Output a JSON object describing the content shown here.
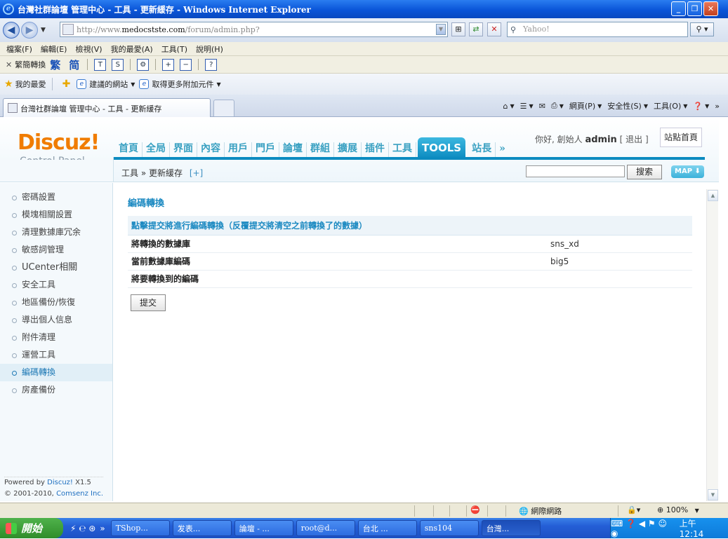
{
  "window": {
    "title": "台灣社群論壇 管理中心 - 工具 - 更新緩存 - Windows Internet Explorer",
    "min": "_",
    "max": "❐",
    "close": "✕"
  },
  "address": {
    "url_prefix": "http://www.",
    "url_domain": "medocstste.com",
    "url_path": "/forum/admin.php?",
    "search_placeholder": "Yahoo!"
  },
  "menu": [
    "檔案(F)",
    "編輯(E)",
    "檢視(V)",
    "我的最愛(A)",
    "工具(T)",
    "說明(H)"
  ],
  "convert_bar": {
    "label": "繁簡轉換",
    "trad": "繁",
    "simp": "简"
  },
  "favorites": {
    "label": "我的最愛",
    "suggested": "建議的網站",
    "addons": "取得更多附加元件"
  },
  "tab": {
    "title": "台灣社群論壇 管理中心 - 工具 - 更新緩存"
  },
  "command_bar": {
    "page": "網頁(P)",
    "safety": "安全性(S)",
    "tools": "工具(O)"
  },
  "header": {
    "logo": "Discuz!",
    "subtitle": "Control Panel",
    "nav": [
      "首頁",
      "全局",
      "界面",
      "內容",
      "用戶",
      "門戶",
      "論壇",
      "群組",
      "擴展",
      "插件",
      "工具",
      "TOOLS",
      "站長",
      "»"
    ],
    "greeting": "你好, 創始人",
    "user": "admin",
    "logout": "[ 退出 ]",
    "site_home": "站點首頁",
    "breadcrumb": "工具 » 更新緩存",
    "breadcrumb_plus": "[+]",
    "search_button": "搜索",
    "map_button": "MAP ⬇"
  },
  "sidebar": {
    "items": [
      "密碼設置",
      "模塊相關設置",
      "清理數據庫冗余",
      "敏感詞管理",
      "UCenter相關",
      "安全工具",
      "地區備份/恢復",
      "導出個人信息",
      "附件清理",
      "運營工具",
      "編碼轉換",
      "房產備份"
    ],
    "active_index": 10,
    "powered_by": "Powered by",
    "powered_name": "Discuz!",
    "powered_version": " X1.5",
    "copyright": "© 2001-2010,",
    "company": "Comsenz Inc."
  },
  "main": {
    "title": "編碼轉換",
    "table_header": "點擊提交將進行編碼轉換（反覆提交將清空之前轉換了的數據）",
    "rows": [
      {
        "key": "將轉換的數據庫",
        "value": "sns_xd"
      },
      {
        "key": "當前數據庫編碼",
        "value": "big5"
      },
      {
        "key": "將要轉換到的編碼",
        "value": ""
      }
    ],
    "submit": "提交"
  },
  "status": {
    "network": "網際網路",
    "zoom": "100%"
  },
  "taskbar": {
    "start": "開始",
    "tasks": [
      "TShop...",
      "发表...",
      "論壇 - ...",
      "root@d...",
      "台北 ...",
      "sns104",
      "台灣..."
    ],
    "active_index": 6,
    "clock": "上午 12:14"
  }
}
